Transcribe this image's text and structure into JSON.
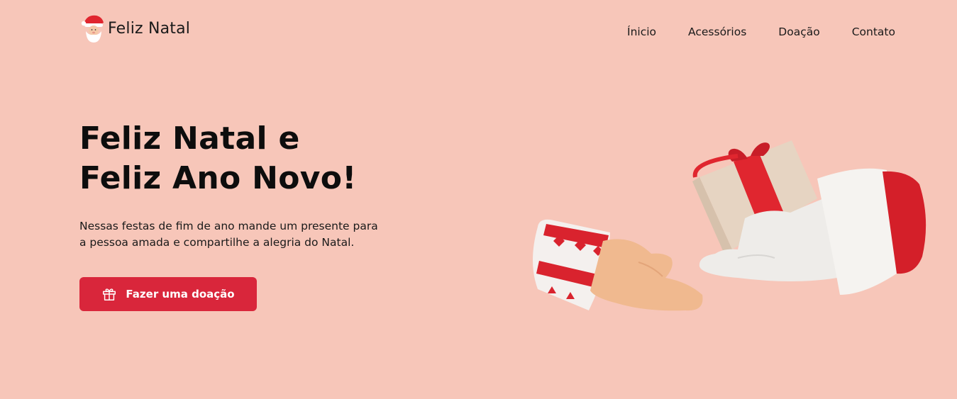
{
  "header": {
    "logo": {
      "icon": "santa-icon",
      "text": "Feliz Natal"
    },
    "nav": [
      {
        "label": "Ínicio"
      },
      {
        "label": "Acessórios"
      },
      {
        "label": "Doação"
      },
      {
        "label": "Contato"
      }
    ]
  },
  "hero": {
    "title_line1": "Feliz Natal e",
    "title_line2": "Feliz Ano Novo!",
    "text_line1": "Nessas festas de fim de ano mande um presente para",
    "text_line2": "a pessoa amada e compartilhe a alegria do Natal.",
    "cta": {
      "icon": "gift-icon",
      "label": "Fazer uma doação"
    }
  },
  "illustration": {
    "name": "gift-exchange-hands-illustration"
  },
  "colors": {
    "background": "#f7c6b9",
    "accent": "#d9263b",
    "text": "#111111"
  }
}
